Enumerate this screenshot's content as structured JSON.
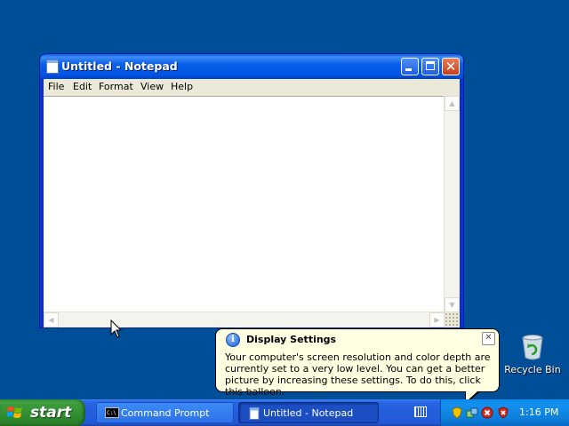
{
  "window": {
    "title": "Untitled - Notepad",
    "menu": [
      "File",
      "Edit",
      "Format",
      "View",
      "Help"
    ],
    "content": ""
  },
  "desktop": {
    "recycle_bin_label": "Recycle Bin"
  },
  "balloon": {
    "title": "Display Settings",
    "body": "Your computer's screen resolution and color depth are currently set to a very low level. You can get a better picture by increasing these settings. To do this, click this balloon."
  },
  "taskbar": {
    "start_label": "start",
    "tasks": [
      {
        "label": "Command Prompt",
        "active": false
      },
      {
        "label": "Untitled - Notepad",
        "active": true
      }
    ],
    "clock": "1:16 PM"
  },
  "colors": {
    "desktop": "#004e98",
    "taskbar": "#245edb",
    "start": "#3c9a3c",
    "balloon": "#ffffe1"
  }
}
